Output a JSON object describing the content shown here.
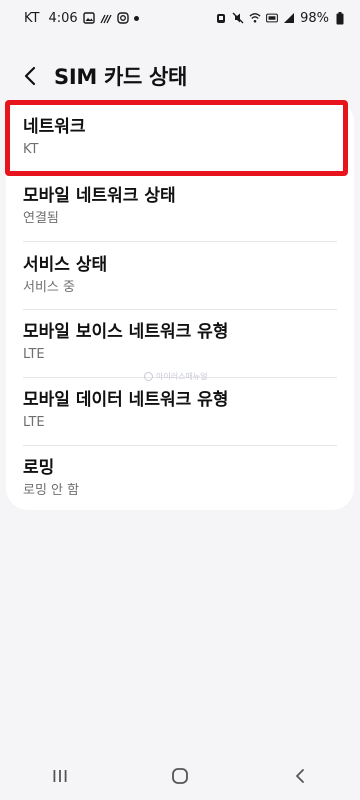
{
  "status_bar": {
    "carrier": "KT",
    "time": "4:06",
    "battery": "98%"
  },
  "header": {
    "title": "SIM 카드 상태"
  },
  "items": [
    {
      "title": "네트워크",
      "subtitle": "KT"
    },
    {
      "title": "모바일 네트워크 상태",
      "subtitle": "연결됨"
    },
    {
      "title": "서비스 상태",
      "subtitle": "서비스 중"
    },
    {
      "title": "모바일 보이스 네트워크 유형",
      "subtitle": "LTE"
    },
    {
      "title": "모바일 데이터 네트워크 유형",
      "subtitle": "LTE"
    },
    {
      "title": "로밍",
      "subtitle": "로밍 안 함"
    }
  ],
  "watermark": {
    "text": "아이러스매뉴얼"
  },
  "colors": {
    "highlight": "#e8141d",
    "background": "#f5f4f6",
    "card": "#ffffff"
  }
}
